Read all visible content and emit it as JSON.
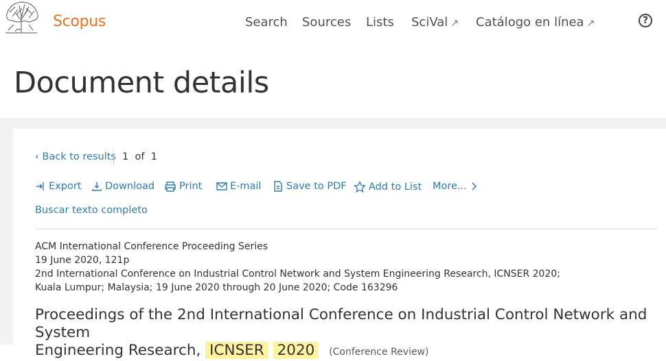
{
  "header": {
    "brand": "Scopus",
    "nav": [
      {
        "label": "Search",
        "external": false
      },
      {
        "label": "Sources",
        "external": false
      },
      {
        "label": "Lists",
        "external": false
      },
      {
        "label": "SciVal",
        "external": true
      },
      {
        "label": "Catálogo en línea",
        "external": true
      }
    ],
    "ext_glyph": "↗",
    "help_glyph": "?"
  },
  "page": {
    "title": "Document details"
  },
  "toolbar": {
    "back_label": "Back to results",
    "pager_current": "1",
    "pager_of": "of",
    "pager_total": "1",
    "actions": [
      {
        "label": "Export",
        "icon": "export-icon"
      },
      {
        "label": "Download",
        "icon": "download-icon"
      },
      {
        "label": "Print",
        "icon": "print-icon"
      },
      {
        "label": "E-mail",
        "icon": "email-icon"
      },
      {
        "label": "Save to PDF",
        "icon": "pdf-icon"
      },
      {
        "label": "Add to List",
        "icon": "star-icon"
      },
      {
        "label": "More...",
        "icon": "chevron-right-icon"
      }
    ],
    "full_text_label": "Buscar texto completo"
  },
  "document": {
    "series": "ACM International Conference Proceeding Series",
    "date_pages": "19 June 2020, 121p",
    "conference": "2nd International Conference on Industrial Control Network and System Engineering Research, ICNSER 2020;",
    "location": "Kuala Lumpur; Malaysia; 19 June 2020 through 20 June 2020; Code 163296",
    "title_line1": "Proceedings of the 2nd International Conference on Industrial Control Network and System",
    "title_line2_prefix": "Engineering Research,",
    "title_highlight1": "ICNSER",
    "title_highlight2": "2020",
    "doc_type": "(Conference Review)"
  },
  "colors": {
    "brand": "#e9711c",
    "link": "#2e7bab",
    "highlight": "#fff3a1"
  }
}
